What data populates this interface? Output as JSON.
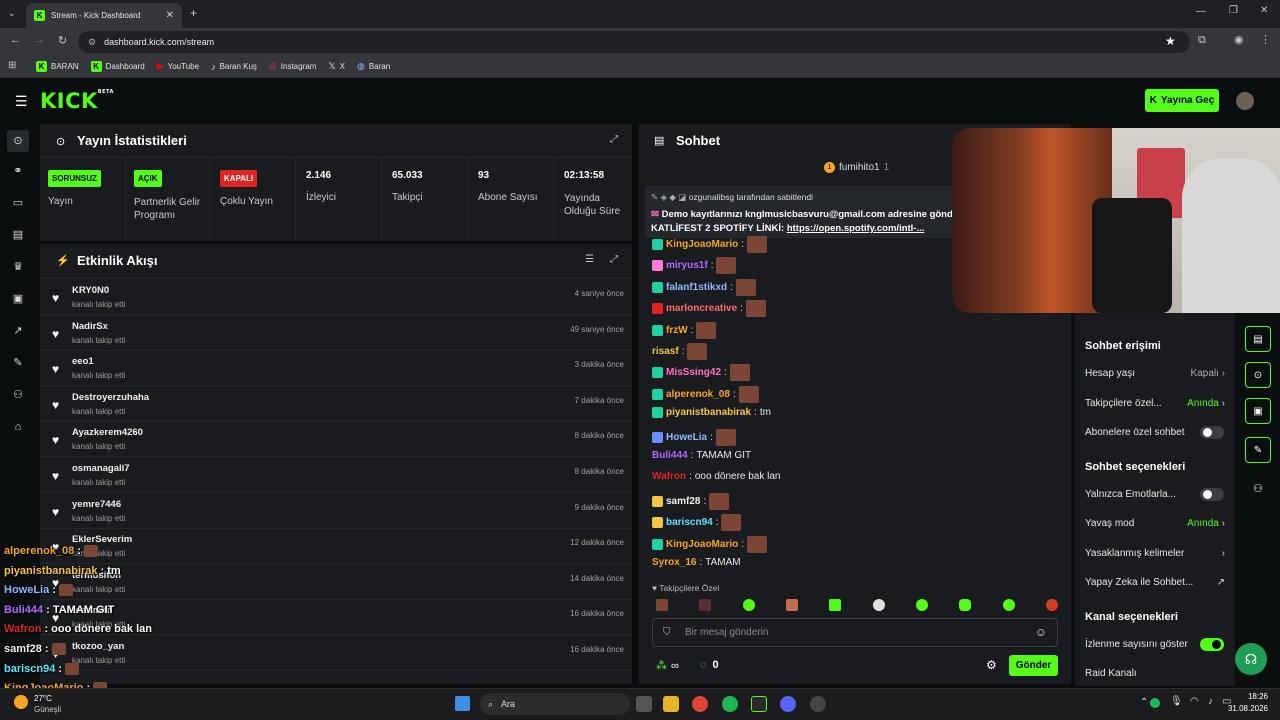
{
  "browser": {
    "tab_title": "Stream - Kick Dashboard",
    "url": "dashboard.kick.com/stream",
    "bookmarks": [
      "BARAN",
      "Dashboard",
      "YouTube",
      "Baran Kuş",
      "Instagram",
      "X",
      "Baran"
    ]
  },
  "header": {
    "logo": "KICK",
    "logo_beta": "BETA",
    "go_live": "Yayına Geç"
  },
  "stats": {
    "title": "Yayın İstatistikleri",
    "cells": [
      {
        "badge": "SORUNSUZ",
        "label": "Yayın",
        "badge_color": "#53fc18"
      },
      {
        "badge": "AÇIK",
        "label": "Partnerlik Gelir Programı",
        "badge_color": "#53fc18"
      },
      {
        "badge": "KAPALI",
        "label": "Çoklu Yayın",
        "badge_color": "#e02424"
      },
      {
        "value": "2.146",
        "label": "İzleyici"
      },
      {
        "value": "65.033",
        "label": "Takipçi"
      },
      {
        "value": "93",
        "label": "Abone Sayısı"
      },
      {
        "value": "02:13:58",
        "label": "Yayında Olduğu Süre"
      }
    ]
  },
  "activity": {
    "title": "Etkinlik Akışı",
    "items": [
      {
        "name": "KRY0N0",
        "sub": "kanalı takip etti",
        "time": "4 saniye önce"
      },
      {
        "name": "NadirSx",
        "sub": "kanalı takip etti",
        "time": "49 saniye önce"
      },
      {
        "name": "eeo1",
        "sub": "kanalı takip etti",
        "time": "3 dakika önce"
      },
      {
        "name": "Destroyerzuhaha",
        "sub": "kanalı takip etti",
        "time": "7 dakika önce"
      },
      {
        "name": "Ayazkerem4260",
        "sub": "kanalı takip etti",
        "time": "8 dakika önce"
      },
      {
        "name": "osmanagali7",
        "sub": "kanalı takip etti",
        "time": "8 dakika önce"
      },
      {
        "name": "yemre7446",
        "sub": "kanalı takip etti",
        "time": "9 dakika önce"
      },
      {
        "name": "EklerSeverim",
        "sub": "kanalı takip etti",
        "time": "12 dakika önce"
      },
      {
        "name": "termosifon",
        "sub": "kanalı takip etti",
        "time": "14 dakika önce"
      },
      {
        "name": "mertmitn",
        "sub": "kanalı takip etti",
        "time": "16 dakika önce"
      },
      {
        "name": "tkozoo_yan",
        "sub": "kanalı takip etti",
        "time": "16 dakika önce"
      }
    ]
  },
  "chat": {
    "title": "Sohbet",
    "top_user": "fumihito1",
    "top_count": "1",
    "pinned_by": "ozgunalibsg tarafından sabitlendi",
    "pinned_line1": "Demo kayıtlarınızı knglmusicbasvuru@gmail.com adresine gönd",
    "pinned_line2_label": "KATLİFEST 2 SPOTİFY LİNKİ:",
    "pinned_line2_link": "https://open.spotify.com/intl-...",
    "messages": [
      {
        "user": "KingJoaoMario",
        "color": "#f5a623",
        "badge": "#1dd1a1",
        "text": ""
      },
      {
        "user": "miryus1f",
        "color": "#b266ff",
        "badge": "#ff7ad9",
        "text": ""
      },
      {
        "user": "falanf1stikxd",
        "color": "#8fb8ff",
        "badge": "#1dd1a1",
        "text": ""
      },
      {
        "user": "marloncreative",
        "color": "#ff6b6b",
        "badge": "#e02424",
        "text": ""
      },
      {
        "user": "frzW",
        "color": "#f5a623",
        "badge": "#1dd1a1",
        "text": ""
      },
      {
        "user": "risasf",
        "color": "#f5c542",
        "badge": "",
        "text": ""
      },
      {
        "user": "MisSsing42",
        "color": "#ff6ec7",
        "badge": "#1dd1a1",
        "text": ""
      },
      {
        "user": "alperenok_08",
        "color": "#f5a623",
        "badge": "#1dd1a1",
        "text": ""
      },
      {
        "user": "piyanistbanabirak",
        "color": "#f5c542",
        "badge": "#1dd1a1",
        "text": "tm"
      },
      {
        "user": "HoweLia",
        "color": "#8fb8ff",
        "badge": "#6a8dff",
        "text": ""
      },
      {
        "user": "Buli444",
        "color": "#b266ff",
        "badge": "",
        "text": "TAMAM GIT"
      },
      {
        "user": "Wafron",
        "color": "#e02424",
        "badge": "",
        "text": "ooo dönere bak lan"
      },
      {
        "user": "samf28",
        "color": "#f0f0f0",
        "badge": "#f5c542",
        "text": ""
      },
      {
        "user": "bariscn94",
        "color": "#5ee6ff",
        "badge": "#f5c542",
        "text": ""
      },
      {
        "user": "KingJoaoMario",
        "color": "#f5a623",
        "badge": "#1dd1a1",
        "text": ""
      },
      {
        "user": "Syrox_16",
        "color": "#f5a623",
        "badge": "",
        "text": "TAMAM"
      }
    ],
    "followers_only": "Takipçilere Özel",
    "input_placeholder": "Bir mesaj gönderin",
    "send_label": "Gönder",
    "count_a": "∞",
    "count_b": "0"
  },
  "settings": {
    "section1": "Sohbet erişimi",
    "account_age": "Hesap yaşı",
    "account_age_value": "Kapalı",
    "followers_only": "Takipçilere özel...",
    "followers_only_value": "Anında",
    "subs_only": "Abonelere özel sohbet",
    "section2": "Sohbet seçenekleri",
    "emotes_only": "Yalnızca Emotlarla...",
    "slow_mode": "Yavaş mod",
    "slow_mode_value": "Anında",
    "banned_words": "Yasaklanmış kelimeler",
    "ai_chat": "Yapay Zeka ile Sohbet...",
    "section3": "Kanal seçenekleri",
    "show_viewers": "İzlenme sayısını göster",
    "raid": "Raid Kanalı"
  },
  "overlay_chat": [
    {
      "user": "alperenok_08",
      "color": "#f5a623",
      "text": ""
    },
    {
      "user": "piyanistbanabirak",
      "color": "#f5c542",
      "text": "tm"
    },
    {
      "user": "HoweLia",
      "color": "#8fb8ff",
      "text": ""
    },
    {
      "user": "Buli444",
      "color": "#b266ff",
      "text": "TAMAM GIT"
    },
    {
      "user": "Wafron",
      "color": "#e02424",
      "text": "ooo dönere bak lan"
    },
    {
      "user": "samf28",
      "color": "#f0f0f0",
      "text": ""
    },
    {
      "user": "bariscn94",
      "color": "#5ee6ff",
      "text": ""
    },
    {
      "user": "KingJoaoMario",
      "color": "#f5a623",
      "text": ""
    }
  ],
  "taskbar": {
    "weather_temp": "27°C",
    "weather_city": "Güneşli",
    "search": "Ara",
    "time": "18:26",
    "date": "31.08.2026"
  }
}
